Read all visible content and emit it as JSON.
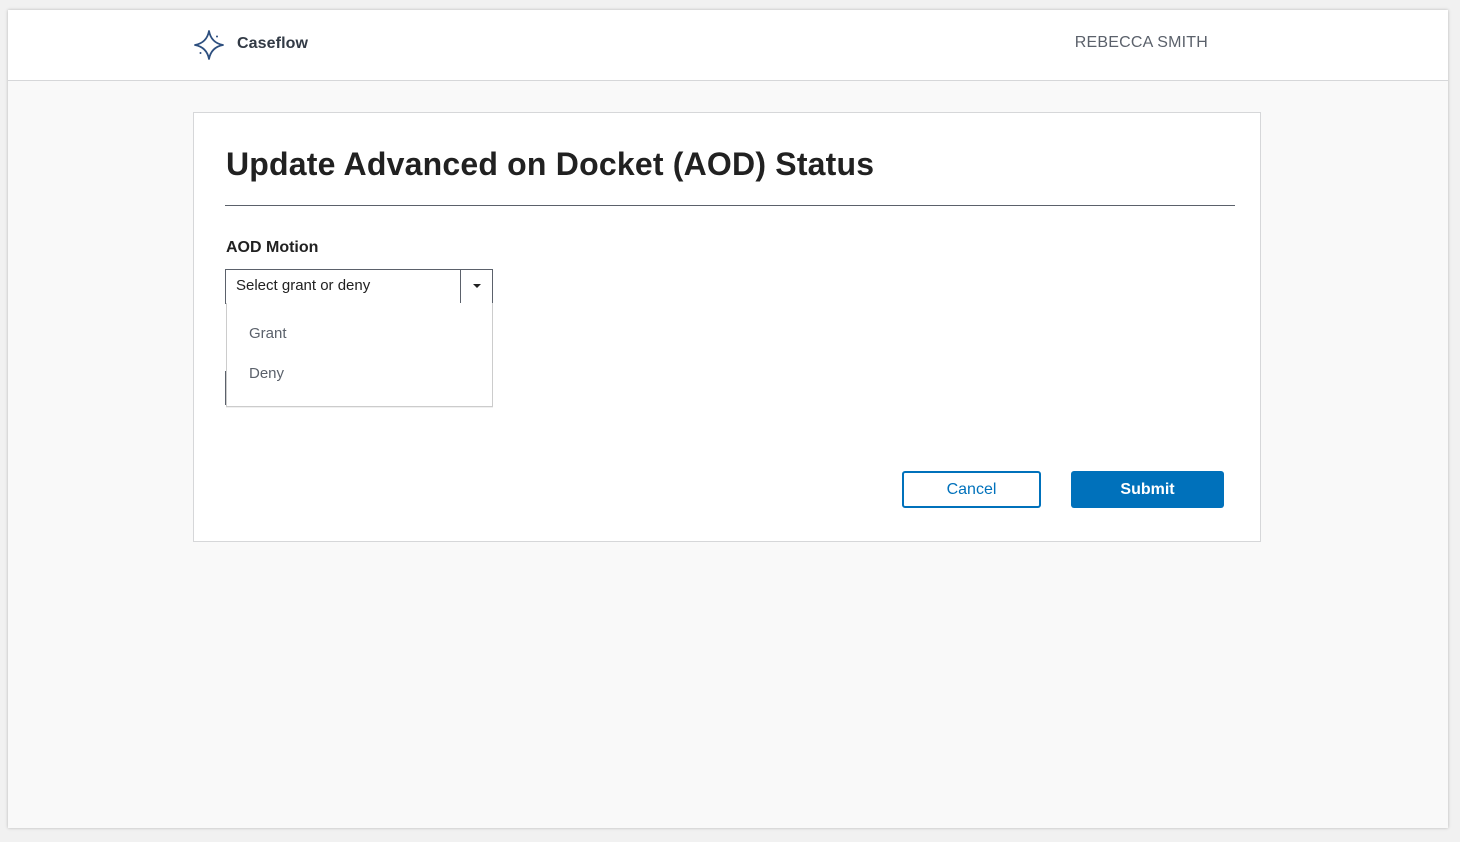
{
  "header": {
    "brand": "Caseflow",
    "user_name": "REBECCA SMITH"
  },
  "page": {
    "title": "Update Advanced on Docket (AOD) Status"
  },
  "aod_motion": {
    "label": "AOD Motion",
    "placeholder": "Select grant or deny",
    "options": [
      {
        "label": "Grant"
      },
      {
        "label": "Deny"
      }
    ]
  },
  "actions": {
    "cancel_label": "Cancel",
    "submit_label": "Submit"
  },
  "colors": {
    "primary": "#0071bb",
    "logo": "#2d4f7f",
    "text": "#212121",
    "muted": "#5b616b"
  },
  "icons": {
    "logo": "caseflow-star-icon",
    "dropdown": "caret-down-icon"
  }
}
